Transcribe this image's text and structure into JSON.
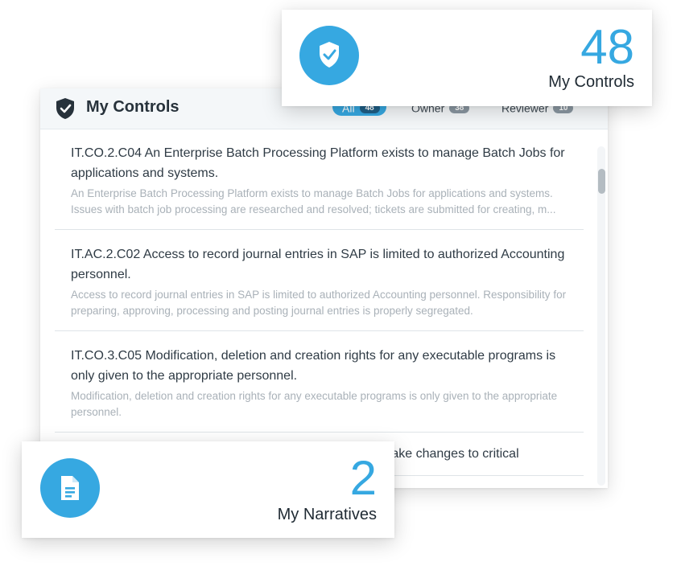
{
  "panel": {
    "title": "My Controls",
    "header_icon": "shield-check-icon",
    "filters": [
      {
        "label": "All",
        "count": "48",
        "active": true
      },
      {
        "label": "Owner",
        "count": "38",
        "active": false
      },
      {
        "label": "Reviewer",
        "count": "10",
        "active": false
      }
    ],
    "items": [
      {
        "title": "IT.CO.2.C04 An Enterprise Batch Processing Platform exists to manage Batch Jobs for applications and systems.",
        "description": "An Enterprise Batch Processing Platform exists to manage Batch Jobs for applications and systems. Issues with batch job processing are researched and resolved; tickets are submitted for creating, m..."
      },
      {
        "title": "IT.AC.2.C02 Access to record journal entries in SAP is limited to authorized Accounting personnel.",
        "description": "Access to record journal entries in SAP is limited to authorized Accounting personnel. Responsibility for preparing, approving, processing and posting journal entries is properly segregated."
      },
      {
        "title": "IT.CO.3.C05 Modification, deletion and creation rights for any executable programs is only given to the appropriate personnel.",
        "description": "Modification, deletion and creation rights for any executable programs is only given to the appropriate personnel."
      },
      {
        "title": "make changes to critical",
        "description": ""
      }
    ]
  },
  "cards": {
    "controls": {
      "value": "48",
      "label": "My Controls",
      "icon": "shield-check-icon"
    },
    "narratives": {
      "value": "2",
      "label": "My Narratives",
      "icon": "document-icon"
    }
  },
  "colors": {
    "accent": "#36a8e1",
    "header_bg": "#f4f7f9",
    "dark_text": "#27323b",
    "muted_text": "#a9b1b8"
  }
}
